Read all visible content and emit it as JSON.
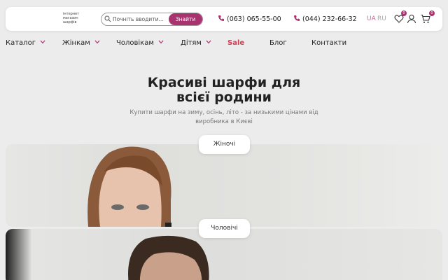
{
  "header": {
    "logo_text": "інтернет магазин шарфів",
    "search": {
      "placeholder": "Почніть вводити...",
      "button": "Знайти"
    },
    "phones": [
      "(063) 065-55-00",
      "(044) 232-66-32"
    ],
    "languages": [
      "UA",
      "RU"
    ],
    "active_language": "UA",
    "wishlist_count": "0",
    "cart_count": "0",
    "icons": [
      "search-icon",
      "phone-icon",
      "heart-icon",
      "user-icon",
      "cart-icon"
    ]
  },
  "nav": {
    "items": [
      {
        "label": "Каталог",
        "dropdown": true
      },
      {
        "label": "Жінкам",
        "dropdown": true
      },
      {
        "label": "Чоловікам",
        "dropdown": true
      },
      {
        "label": "Дітям",
        "dropdown": true
      },
      {
        "label": "Sale",
        "dropdown": false
      },
      {
        "label": "Блог",
        "dropdown": false
      },
      {
        "label": "Контакти",
        "dropdown": false
      }
    ]
  },
  "hero": {
    "title_line1": "Красиві шарфи для",
    "title_line2": "всієї родини",
    "subtitle_line1": "Купити шарфи на зиму, осінь, літо - за низькими цінами від",
    "subtitle_line2": "виробника в Києві"
  },
  "categories": [
    {
      "label": "Жіночі"
    },
    {
      "label": "Чоловічі"
    }
  ],
  "colors": {
    "accent": "#a9336f",
    "sale": "#d63a4e",
    "background": "#ececec"
  }
}
